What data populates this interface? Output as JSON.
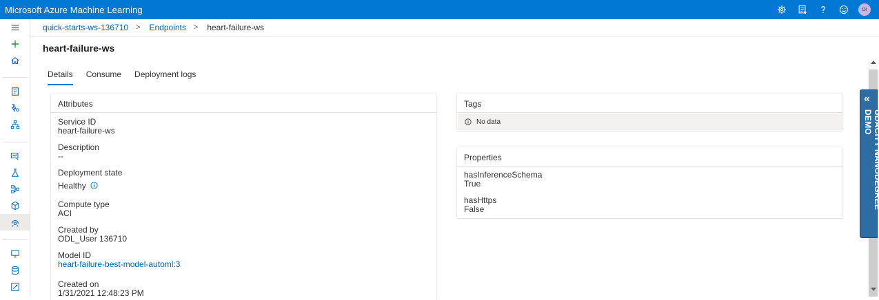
{
  "app": {
    "title": "Microsoft Azure Machine Learning"
  },
  "topbar": {
    "icons": [
      "gear-icon",
      "feedback-list-icon",
      "help-icon",
      "smiley-icon"
    ],
    "avatar_initials": "OI",
    "color": "#0078d4"
  },
  "rail": {
    "items": [
      "hamburger-icon",
      "plus-icon",
      "home-icon",
      "notebook-icon",
      "automl-icon",
      "designer-icon",
      "datasets-icon",
      "experiments-icon",
      "pipelines-icon",
      "models-icon",
      "endpoints-icon",
      "compute-icon",
      "datastores-icon",
      "labeling-icon"
    ]
  },
  "breadcrumb": {
    "workspace": "quick-starts-ws-136710",
    "section": "Endpoints",
    "current": "heart-failure-ws"
  },
  "page": {
    "title": "heart-failure-ws"
  },
  "tabs": [
    {
      "label": "Details",
      "active": true
    },
    {
      "label": "Consume",
      "active": false
    },
    {
      "label": "Deployment logs",
      "active": false
    }
  ],
  "attributes": {
    "header": "Attributes",
    "service_id": {
      "label": "Service ID",
      "value": "heart-failure-ws"
    },
    "description": {
      "label": "Description",
      "value": "--"
    },
    "deployment_state": {
      "label": "Deployment state",
      "value": "Healthy"
    },
    "compute_type": {
      "label": "Compute type",
      "value": "ACI"
    },
    "created_by": {
      "label": "Created by",
      "value": "ODL_User 136710"
    },
    "model_id": {
      "label": "Model ID",
      "value": "heart-failure-best-model-automl:3"
    },
    "created_on": {
      "label": "Created on",
      "value": "1/31/2021 12:48:23 PM"
    }
  },
  "tags": {
    "header": "Tags",
    "empty_text": "No data"
  },
  "properties": {
    "header": "Properties",
    "items": [
      {
        "label": "hasInferenceSchema",
        "value": "True"
      },
      {
        "label": "hasHttps",
        "value": "False"
      }
    ]
  },
  "side_tab": {
    "label": "UDACITY NANODEGREE DEMO",
    "chevron": "«",
    "color": "#2e6da4"
  }
}
